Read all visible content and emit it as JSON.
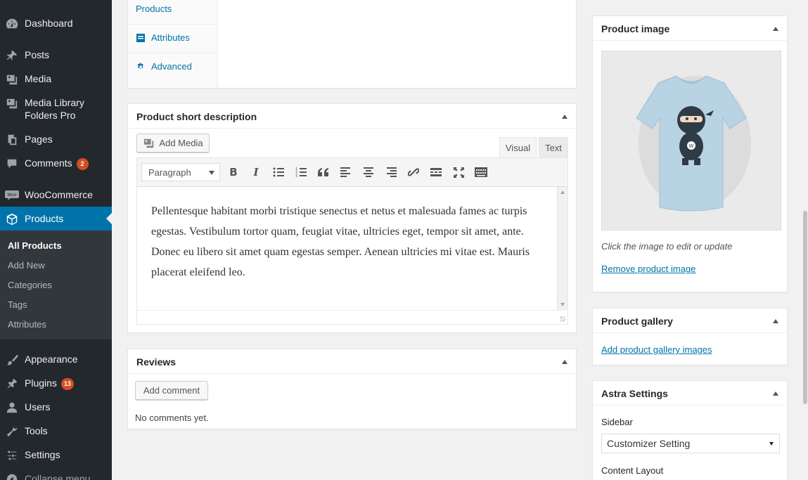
{
  "sidebar": {
    "items": [
      {
        "label": "Dashboard",
        "icon": "dashboard-icon"
      },
      {
        "label": "Posts",
        "icon": "pin-icon"
      },
      {
        "label": "Media",
        "icon": "media-icon"
      },
      {
        "label": "Media Library Folders Pro",
        "icon": "media-icon"
      },
      {
        "label": "Pages",
        "icon": "pages-icon"
      },
      {
        "label": "Comments",
        "icon": "comment-icon",
        "badge": "2"
      },
      {
        "label": "WooCommerce",
        "icon": "woo-icon"
      },
      {
        "label": "Products",
        "icon": "cube-icon"
      },
      {
        "label": "Appearance",
        "icon": "brush-icon"
      },
      {
        "label": "Plugins",
        "icon": "plug-icon",
        "badge": "13"
      },
      {
        "label": "Users",
        "icon": "user-icon"
      },
      {
        "label": "Tools",
        "icon": "wrench-icon"
      },
      {
        "label": "Settings",
        "icon": "settings-icon"
      },
      {
        "label": "Collapse menu",
        "icon": "collapse-icon"
      }
    ],
    "submenu": [
      "All Products",
      "Add New",
      "Categories",
      "Tags",
      "Attributes"
    ]
  },
  "product_data": {
    "tabs": [
      "Products",
      "Attributes",
      "Advanced"
    ]
  },
  "short_description": {
    "title": "Product short description",
    "add_media": "Add Media",
    "tab_visual": "Visual",
    "tab_text": "Text",
    "format_select": "Paragraph",
    "content": "Pellentesque habitant morbi tristique senectus et netus et malesuada fames ac turpis egestas. Vestibulum tortor quam, feugiat vitae, ultricies eget, tempor sit amet, ante. Donec eu libero sit amet quam egestas semper. Aenean ultricies mi vitae est. Mauris placerat eleifend leo."
  },
  "reviews": {
    "title": "Reviews",
    "add_comment": "Add comment",
    "empty": "No comments yet."
  },
  "product_image": {
    "title": "Product image",
    "hint": "Click the image to edit or update",
    "remove": "Remove product image",
    "shirt_color": "#b7d3e4"
  },
  "product_gallery": {
    "title": "Product gallery",
    "add": "Add product gallery images"
  },
  "astra": {
    "title": "Astra Settings",
    "sidebar_label": "Sidebar",
    "sidebar_value": "Customizer Setting",
    "layout_label": "Content Layout"
  },
  "colors": {
    "sidebar_bg": "#23282d",
    "active": "#0073aa",
    "badge": "#d54e21"
  }
}
